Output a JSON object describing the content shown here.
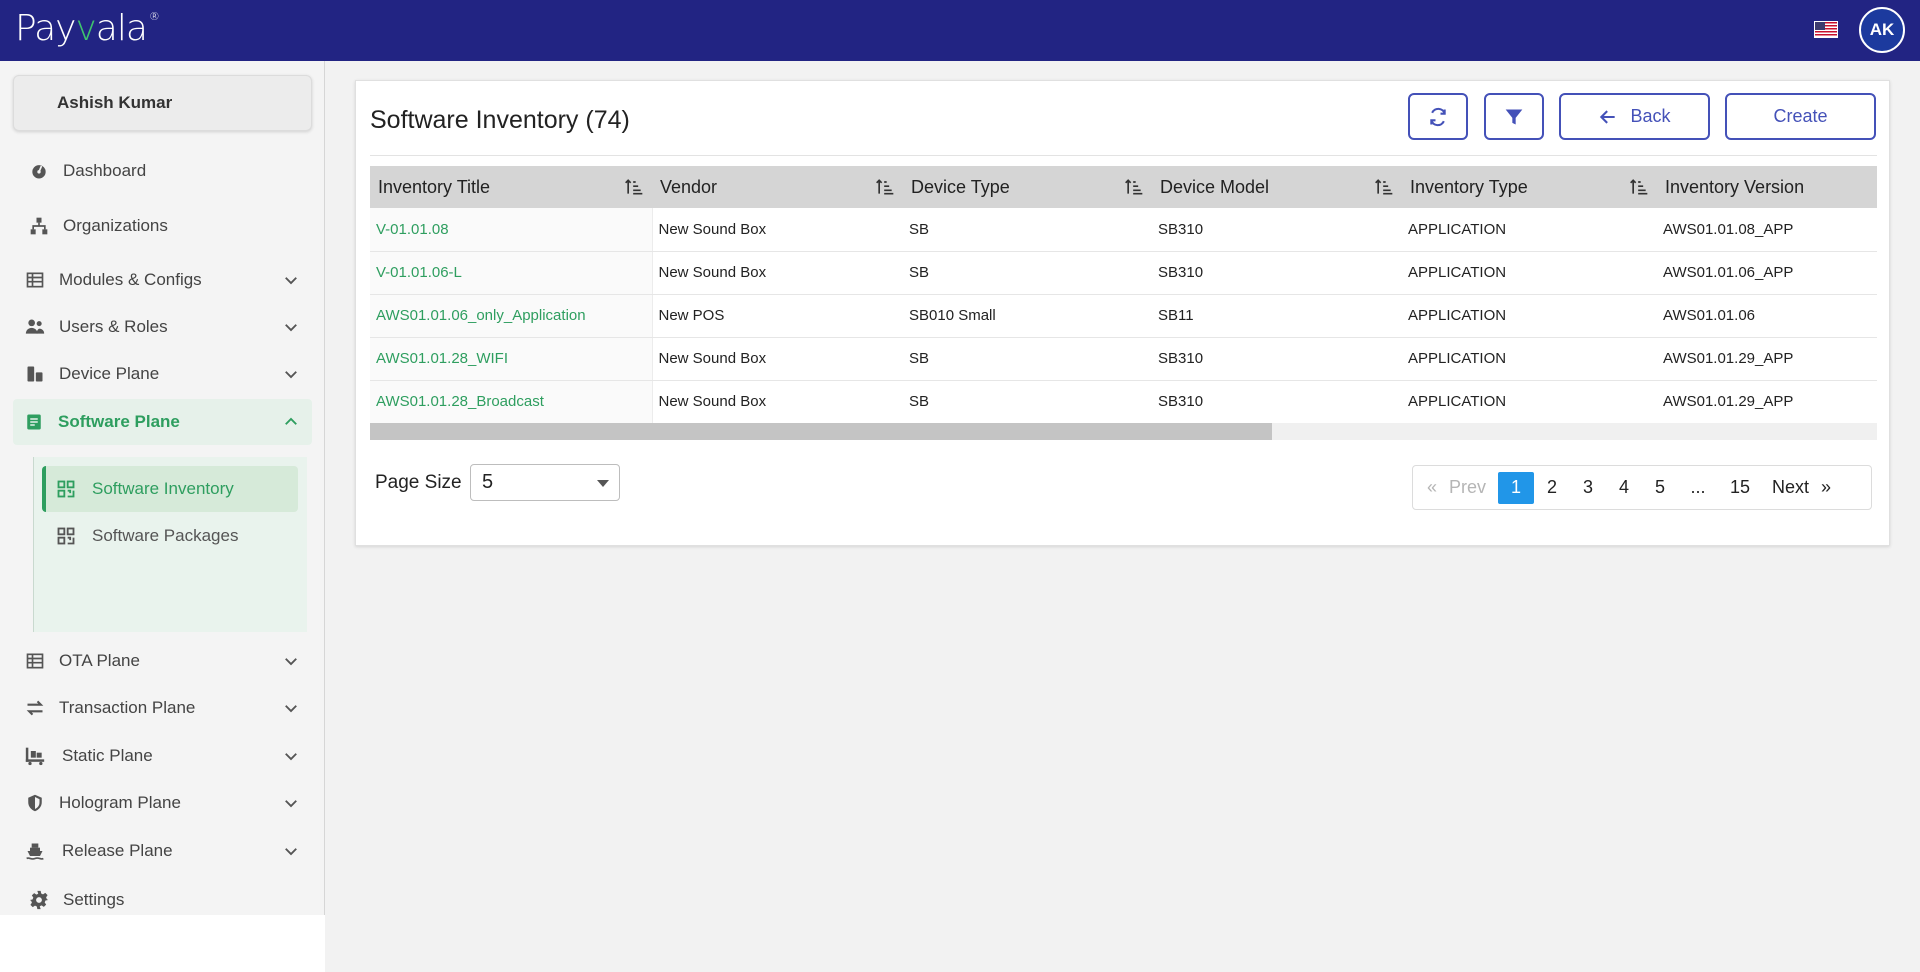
{
  "brand": {
    "logo_prefix": "Pay",
    "logo_check": "v",
    "logo_suffix": "ala",
    "logo_mark": "®"
  },
  "header": {
    "avatar_initials": "AK"
  },
  "user": {
    "name": "Ashish Kumar"
  },
  "sidebar": {
    "items": [
      {
        "label": "Dashboard"
      },
      {
        "label": "Organizations"
      },
      {
        "label": "Modules & Configs"
      },
      {
        "label": "Users & Roles"
      },
      {
        "label": "Device Plane"
      },
      {
        "label": "Software Plane"
      },
      {
        "label": "OTA Plane"
      },
      {
        "label": "Transaction Plane"
      },
      {
        "label": "Static Plane"
      },
      {
        "label": "Hologram Plane"
      },
      {
        "label": "Release Plane"
      },
      {
        "label": "Settings"
      }
    ],
    "submenu": [
      {
        "label": "Software Inventory"
      },
      {
        "label": "Software Packages"
      }
    ]
  },
  "page": {
    "title": "Software Inventory (74)",
    "back_label": "Back",
    "create_label": "Create"
  },
  "table": {
    "columns": [
      "Inventory Title",
      "Vendor",
      "Device Type",
      "Device Model",
      "Inventory Type",
      "Inventory Version"
    ],
    "rows": [
      [
        "V-01.01.08",
        "New Sound Box",
        "SB",
        "SB310",
        "APPLICATION",
        "AWS01.01.08_APP"
      ],
      [
        "V-01.01.06-L",
        "New Sound Box",
        "SB",
        "SB310",
        "APPLICATION",
        "AWS01.01.06_APP"
      ],
      [
        "AWS01.01.06_only_Application",
        "New POS",
        "SB010 Small",
        "SB11",
        "APPLICATION",
        "AWS01.01.06"
      ],
      [
        "AWS01.01.28_WIFI",
        "New Sound Box",
        "SB",
        "SB310",
        "APPLICATION",
        "AWS01.01.29_APP"
      ],
      [
        "AWS01.01.28_Broadcast",
        "New Sound Box",
        "SB",
        "SB310",
        "APPLICATION",
        "AWS01.01.29_APP"
      ]
    ]
  },
  "footer": {
    "page_size_label": "Page Size",
    "page_size_value": "5",
    "pager": {
      "first": "«",
      "prev": "Prev",
      "pages": [
        "1",
        "2",
        "3",
        "4",
        "5",
        "...",
        "15"
      ],
      "current": "1",
      "next": "Next",
      "last": "»"
    }
  },
  "colors": {
    "header_bg": "#222483",
    "accent_green": "#2e9e5f",
    "button_blue": "#4451b8",
    "pager_active": "#2196e8"
  }
}
